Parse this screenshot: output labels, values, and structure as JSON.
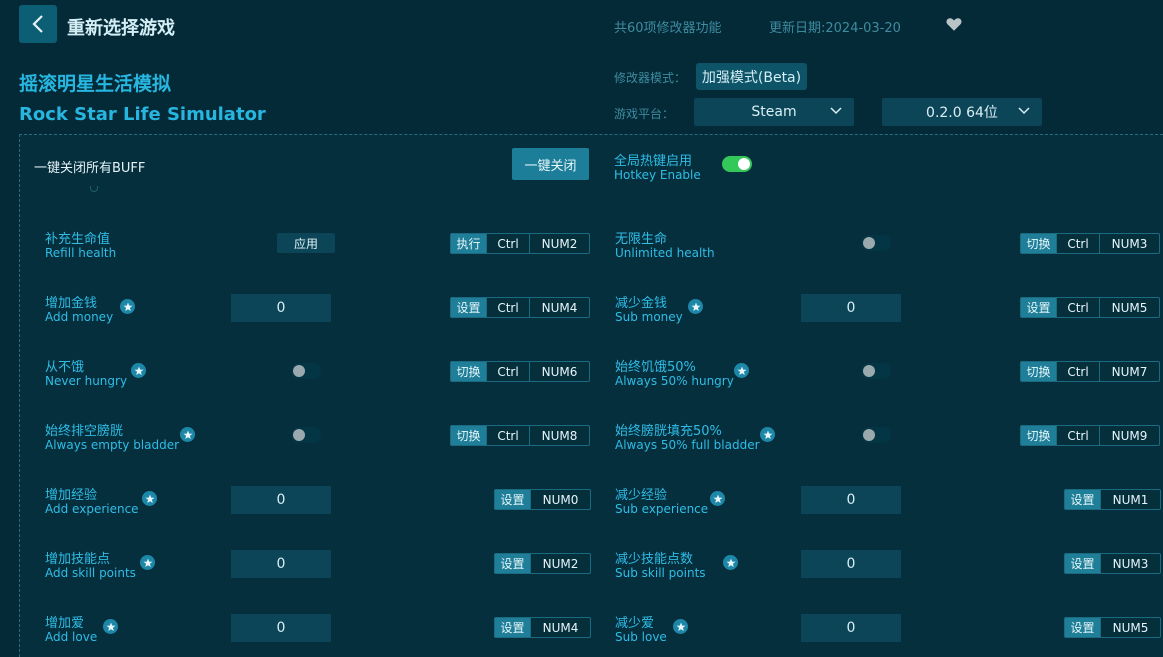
{
  "header": {
    "title": "重新选择游戏",
    "feature_count": "共60项修改器功能",
    "update_date": "更新日期:2024-03-20"
  },
  "game": {
    "name_cn": "摇滚明星生活模拟",
    "name_en": "Rock Star Life Simulator"
  },
  "mode": {
    "label": "修改器模式：",
    "value": "加强模式(Beta)"
  },
  "platform": {
    "label": "游戏平台：",
    "value": "Steam",
    "version": "0.2.0 64位"
  },
  "close_all": {
    "label": "一键关闭所有BUFF",
    "button": "一键关闭"
  },
  "hotkey": {
    "cn": "全局热键启用",
    "en": "Hotkey Enable",
    "enabled": true
  },
  "items": [
    {
      "cn": "补充生命值",
      "en": "Refill health",
      "control": "apply",
      "control_label": "应用",
      "action": "执行",
      "keys": [
        "Ctrl",
        "NUM2"
      ],
      "star": false
    },
    {
      "cn": "无限生命",
      "en": "Unlimited health",
      "control": "toggle",
      "on": false,
      "action": "切换",
      "keys": [
        "Ctrl",
        "NUM3"
      ],
      "star": false
    },
    {
      "cn": "增加金钱",
      "en": "Add money",
      "control": "input",
      "value": "0",
      "action": "设置",
      "keys": [
        "Ctrl",
        "NUM4"
      ],
      "star": true
    },
    {
      "cn": "减少金钱",
      "en": "Sub money",
      "control": "input",
      "value": "0",
      "action": "设置",
      "keys": [
        "Ctrl",
        "NUM5"
      ],
      "star": true
    },
    {
      "cn": "从不饿",
      "en": "Never hungry",
      "control": "toggle",
      "on": false,
      "action": "切换",
      "keys": [
        "Ctrl",
        "NUM6"
      ],
      "star": true
    },
    {
      "cn": "始终饥饿50%",
      "en": "Always 50% hungry",
      "control": "toggle",
      "on": false,
      "action": "切换",
      "keys": [
        "Ctrl",
        "NUM7"
      ],
      "star": true
    },
    {
      "cn": "始终排空膀胱",
      "en": "Always empty bladder",
      "control": "toggle",
      "on": false,
      "action": "切换",
      "keys": [
        "Ctrl",
        "NUM8"
      ],
      "star": true
    },
    {
      "cn": "始终膀胱填充50%",
      "en": "Always 50% full bladder",
      "control": "toggle",
      "on": false,
      "action": "切换",
      "keys": [
        "Ctrl",
        "NUM9"
      ],
      "star": true
    },
    {
      "cn": "增加经验",
      "en": "Add experience",
      "control": "input",
      "value": "0",
      "action": "设置",
      "keys": [
        "NUM0"
      ],
      "star": true
    },
    {
      "cn": "减少经验",
      "en": "Sub experience",
      "control": "input",
      "value": "0",
      "action": "设置",
      "keys": [
        "NUM1"
      ],
      "star": true
    },
    {
      "cn": "增加技能点",
      "en": "Add skill points",
      "control": "input",
      "value": "0",
      "action": "设置",
      "keys": [
        "NUM2"
      ],
      "star": true
    },
    {
      "cn": "减少技能点数",
      "en": "Sub skill points",
      "control": "input",
      "value": "0",
      "action": "设置",
      "keys": [
        "NUM3"
      ],
      "star": true
    },
    {
      "cn": "增加爱",
      "en": "Add love",
      "control": "input",
      "value": "0",
      "action": "设置",
      "keys": [
        "NUM4"
      ],
      "star": true
    },
    {
      "cn": "减少爱",
      "en": "Sub love",
      "control": "input",
      "value": "0",
      "action": "设置",
      "keys": [
        "NUM5"
      ],
      "star": true
    }
  ]
}
